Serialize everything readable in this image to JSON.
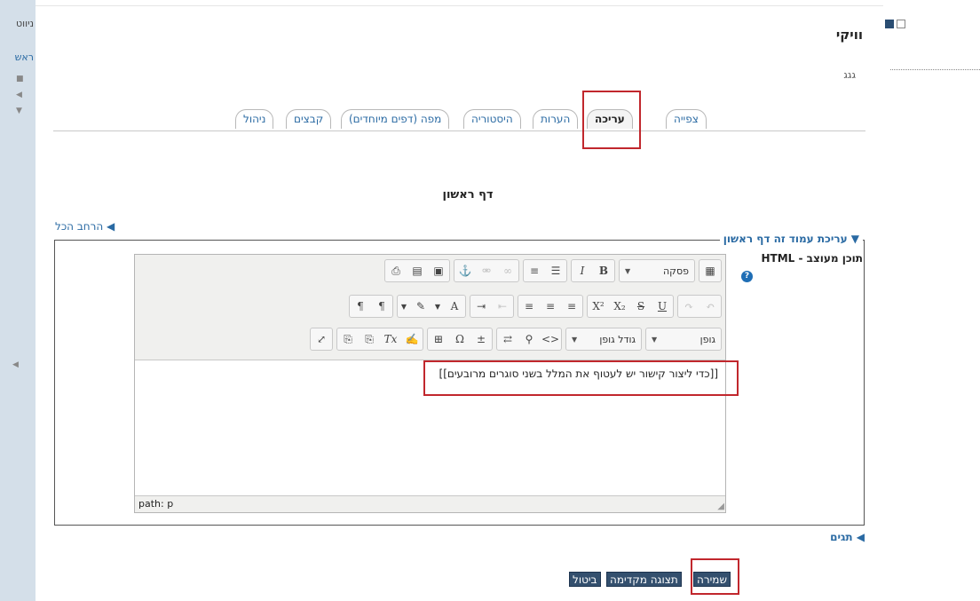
{
  "nav": {
    "title": "ניווט",
    "home": "ראש"
  },
  "right": {},
  "page": {
    "heading": "וויקי",
    "subtitle": "גגג"
  },
  "tabs": [
    {
      "label": "צפייה",
      "active": false
    },
    {
      "label": "עריכה",
      "active": true
    },
    {
      "label": "הערות",
      "active": false
    },
    {
      "label": "היסטוריה",
      "active": false
    },
    {
      "label": "מפה (דפים מיוחדים)",
      "active": false
    },
    {
      "label": "קבצים",
      "active": false
    },
    {
      "label": "ניהול",
      "active": false
    }
  ],
  "edit": {
    "title": "דף ראשון",
    "expand_all": "הרחב הכל",
    "legend": "עריכת עמוד זה דף ראשון",
    "field_label": "תוכן מעוצב - HTML",
    "help": "?"
  },
  "editor": {
    "paragraph_select": "פסקה",
    "font_select": "גופן",
    "font_size_select": "גודל גופן",
    "content": "[[כדי ליצור קישור יש לעטוף את המלל בשני סוגרים מרובעים]]",
    "path": "path: p"
  },
  "tags": {
    "label": "תגים"
  },
  "buttons": {
    "save": "שמירה",
    "preview": "תצוגה מקדימה",
    "cancel": "ביטול"
  },
  "colors": {
    "accent": "#2a6aa3",
    "button_bg": "#34506e",
    "highlight": "#c1272d",
    "nav_bg": "#d4dfe9"
  }
}
